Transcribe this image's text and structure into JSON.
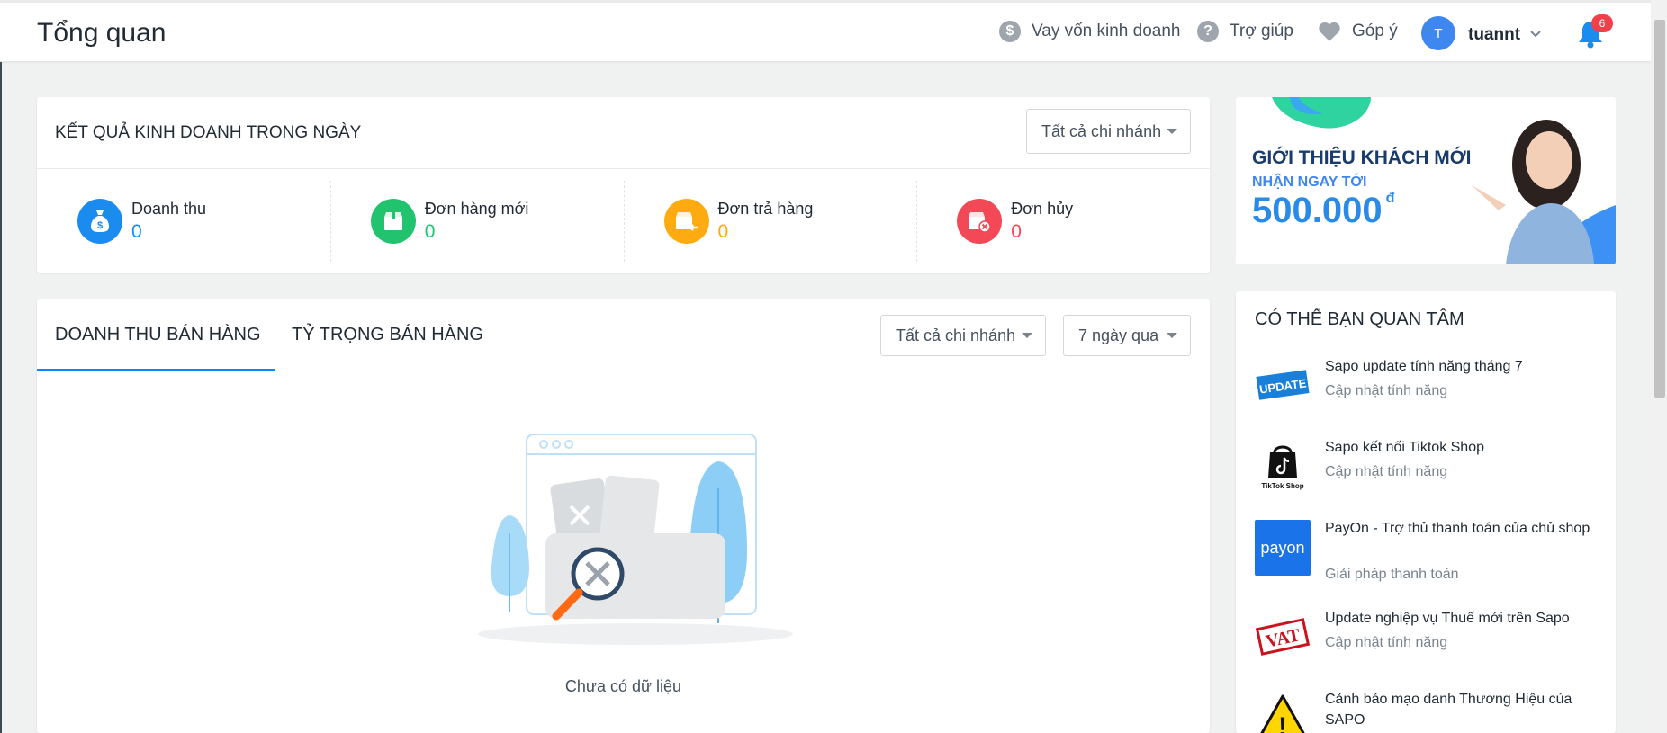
{
  "header": {
    "title": "Tổng quan",
    "loan_label": "Vay vốn kinh doanh",
    "help_label": "Trợ giúp",
    "feedback_label": "Góp ý",
    "avatar_initial": "T",
    "username": "tuannt",
    "notification_count": "6"
  },
  "business": {
    "title": "KẾT QUẢ KINH DOANH TRONG NGÀY",
    "branch_select": "Tất cả chi nhánh",
    "stats": [
      {
        "label": "Doanh thu",
        "value": "0",
        "color": "#1a8cf0",
        "icon": "money-bag-icon"
      },
      {
        "label": "Đơn hàng mới",
        "value": "0",
        "color": "#22c36f",
        "icon": "package-icon"
      },
      {
        "label": "Đơn trả hàng",
        "value": "0",
        "color": "#fdab10",
        "icon": "return-package-icon"
      },
      {
        "label": "Đơn hủy",
        "value": "0",
        "color": "#f34956",
        "icon": "cancel-package-icon"
      }
    ]
  },
  "sales": {
    "tabs": [
      "DOANH THU BÁN HÀNG",
      "TỶ TRỌNG BÁN HÀNG"
    ],
    "branch_select": "Tất cả chi nhánh",
    "period_select": "7 ngày qua",
    "empty_text": "Chưa có dữ liệu"
  },
  "promo": {
    "line1": "GIỚI THIỆU KHÁCH MỚI",
    "line2": "NHẬN NGAY TỚI",
    "amount": "500.000",
    "currency": "đ"
  },
  "interest": {
    "title": "CÓ THỂ BẠN QUAN TÂM",
    "items": [
      {
        "title": "Sapo update tính năng tháng 7",
        "sub": "Cập nhật tính năng",
        "thumb": "UPDATE"
      },
      {
        "title": "Sapo kết nối Tiktok Shop",
        "sub": "Cập nhật tính năng",
        "thumb": "TikTok Shop"
      },
      {
        "title": "PayOn - Trợ thủ thanh toán của chủ shop",
        "sub": "Giải pháp thanh toán",
        "thumb": "payon"
      },
      {
        "title": "Update nghiệp vụ Thuế mới trên Sapo",
        "sub": "Cập nhật tính năng",
        "thumb": "VAT"
      },
      {
        "title": "Cảnh báo mạo danh Thương Hiệu của SAPO",
        "sub": "",
        "thumb": "!"
      }
    ]
  }
}
